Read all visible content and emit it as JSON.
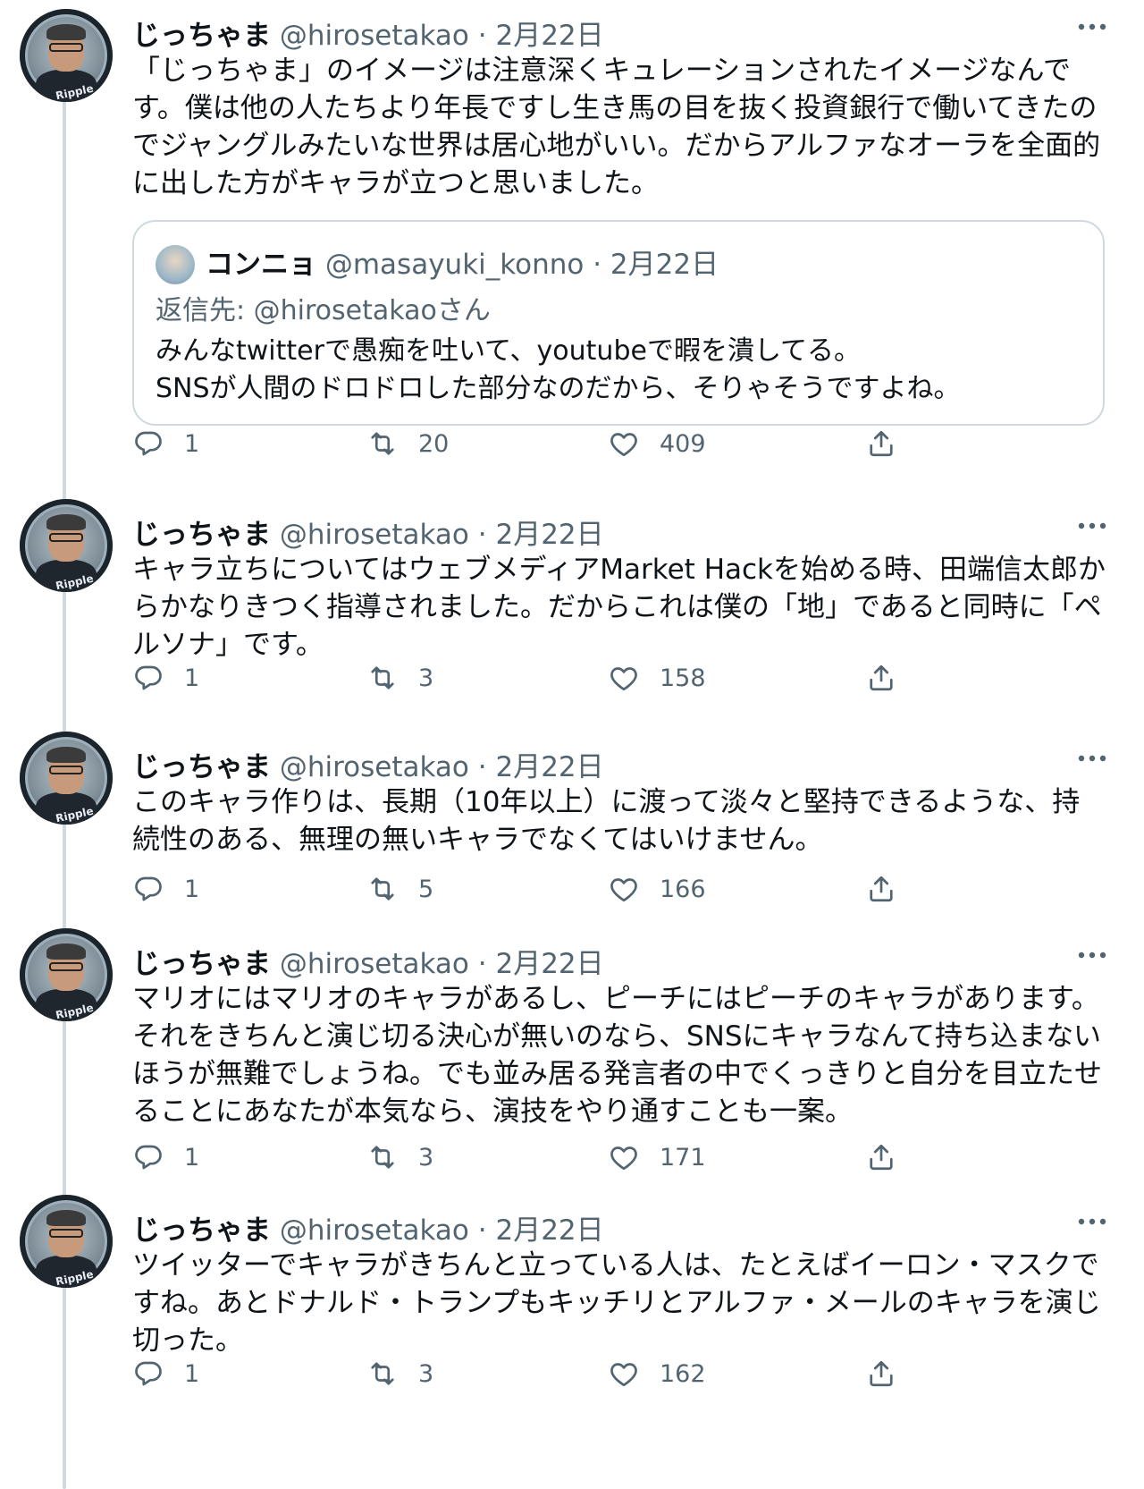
{
  "tweets": [
    {
      "name": "じっちゃま",
      "handle": "@hirosetakao",
      "separator": "·",
      "date": "2月22日",
      "text": "「じっちゃま」のイメージは注意深くキュレーションされたイメージなんです。僕は他の人たちより年長ですし生き馬の目を抜く投資銀行で働いてきたのでジャングルみたいな世界は居心地がいい。だからアルファなオーラを全面的に出した方がキャラが立つと思いました。",
      "avatar_badge": "Ripple",
      "quote": {
        "name": "コンニョ",
        "handle": "@masayuki_konno",
        "separator": "·",
        "date": "2月22日",
        "reply_to": "返信先: @hirosetakaoさん",
        "text": "みんなtwitterで愚痴を吐いて、youtubeで暇を潰してる。\nSNSが人間のドロドロした部分なのだから、そりゃそうですよね。"
      },
      "replies": "1",
      "retweets": "20",
      "likes": "409"
    },
    {
      "name": "じっちゃま",
      "handle": "@hirosetakao",
      "separator": "·",
      "date": "2月22日",
      "text": "キャラ立ちについてはウェブメディアMarket Hackを始める時、田端信太郎からかなりきつく指導されました。だからこれは僕の「地」であると同時に「ペルソナ」です。",
      "avatar_badge": "Ripple",
      "replies": "1",
      "retweets": "3",
      "likes": "158"
    },
    {
      "name": "じっちゃま",
      "handle": "@hirosetakao",
      "separator": "·",
      "date": "2月22日",
      "text": "このキャラ作りは、長期（10年以上）に渡って淡々と堅持できるような、持続性のある、無理の無いキャラでなくてはいけません。",
      "avatar_badge": "Ripple",
      "replies": "1",
      "retweets": "5",
      "likes": "166"
    },
    {
      "name": "じっちゃま",
      "handle": "@hirosetakao",
      "separator": "·",
      "date": "2月22日",
      "text": "マリオにはマリオのキャラがあるし、ピーチにはピーチのキャラがあります。それをきちんと演じ切る決心が無いのなら、SNSにキャラなんて持ち込まないほうが無難でしょうね。でも並み居る発言者の中でくっきりと自分を目立たせることにあなたが本気なら、演技をやり通すことも一案。",
      "avatar_badge": "Ripple",
      "replies": "1",
      "retweets": "3",
      "likes": "171"
    },
    {
      "name": "じっちゃま",
      "handle": "@hirosetakao",
      "separator": "·",
      "date": "2月22日",
      "text": "ツイッターでキャラがきちんと立っている人は、たとえばイーロン・マスクですね。あとドナルド・トランプもキッチリとアルファ・メールのキャラを演じ切った。",
      "avatar_badge": "Ripple",
      "replies": "1",
      "retweets": "3",
      "likes": "162"
    }
  ],
  "colors": {
    "text": "#0f1419",
    "secondary": "#536471",
    "border": "#cfd9de",
    "thread_line": "#cfd9de"
  },
  "icons": [
    "more-icon",
    "reply-icon",
    "retweet-icon",
    "like-icon",
    "share-icon"
  ]
}
